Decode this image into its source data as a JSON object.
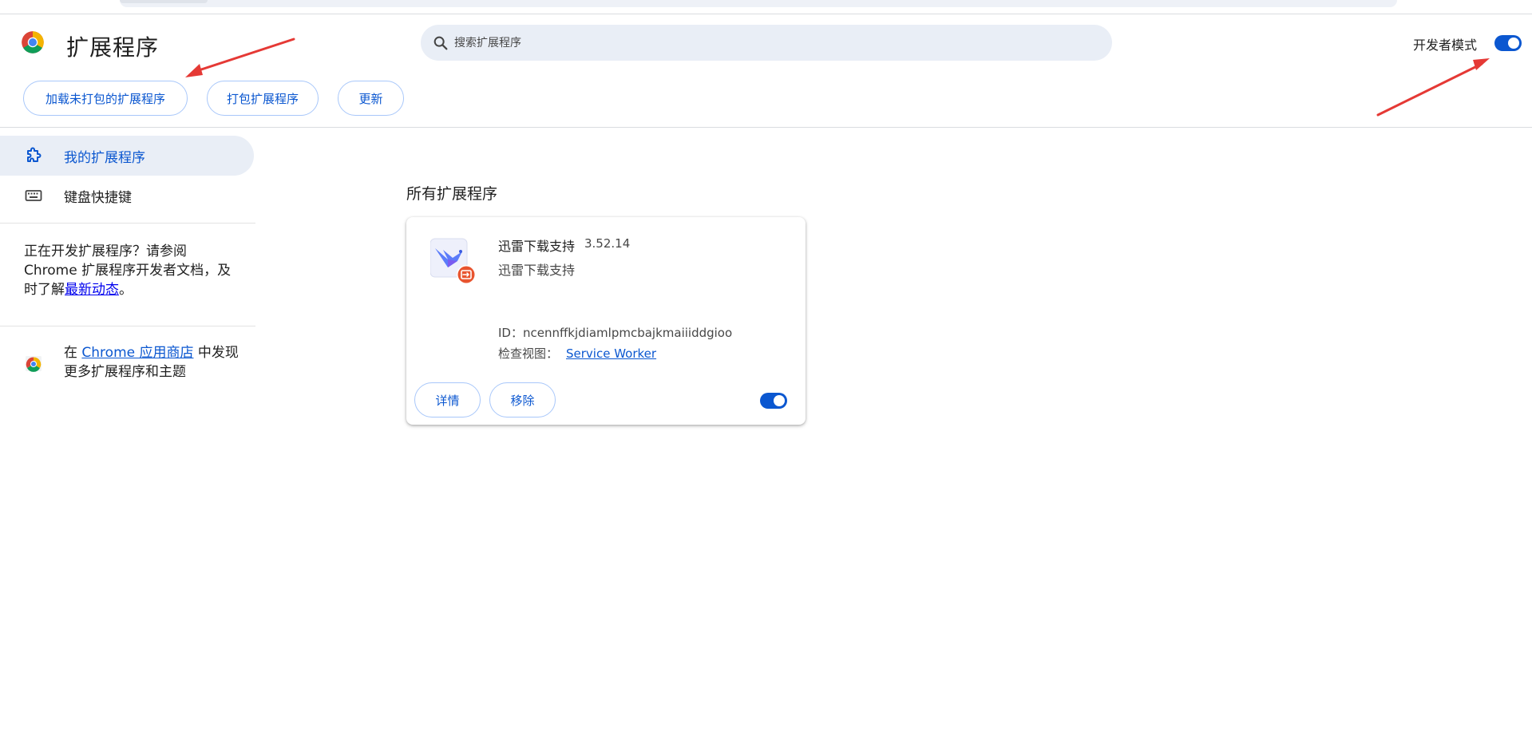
{
  "header": {
    "title": "扩展程序",
    "search_placeholder": "搜索扩展程序",
    "dev_mode_label": "开发者模式",
    "dev_mode_enabled": true,
    "buttons": {
      "load_unpacked": "加载未打包的扩展程序",
      "pack": "打包扩展程序",
      "update": "更新"
    }
  },
  "sidebar": {
    "items": [
      {
        "label": "我的扩展程序",
        "icon": "extensions-icon",
        "active": true
      },
      {
        "label": "键盘快捷键",
        "icon": "keyboard-icon",
        "active": false
      }
    ],
    "dev_note": {
      "text_before": "正在开发扩展程序？请参阅 Chrome 扩展程序开发者文档，及时了解",
      "link": "最新动态",
      "text_after": "。"
    },
    "store_note": {
      "text_before": "在 ",
      "link": "Chrome 应用商店",
      "text_after": " 中发现更多扩展程序和主题"
    }
  },
  "main": {
    "section_title": "所有扩展程序",
    "extension": {
      "name": "迅雷下载支持",
      "version": "3.52.14",
      "description": "迅雷下载支持",
      "id_text": "ID：ncennffkjdiamlpmcbajkmaiiiddgioo",
      "inspect_label": "检查视图：",
      "inspect_link": "Service Worker",
      "details_label": "详情",
      "remove_label": "移除",
      "enabled": true
    }
  },
  "colors": {
    "accent": "#0b57d0",
    "button_border": "#a8c7fa",
    "search_bg": "#e9eef6",
    "annotation_arrow": "#e53935"
  }
}
